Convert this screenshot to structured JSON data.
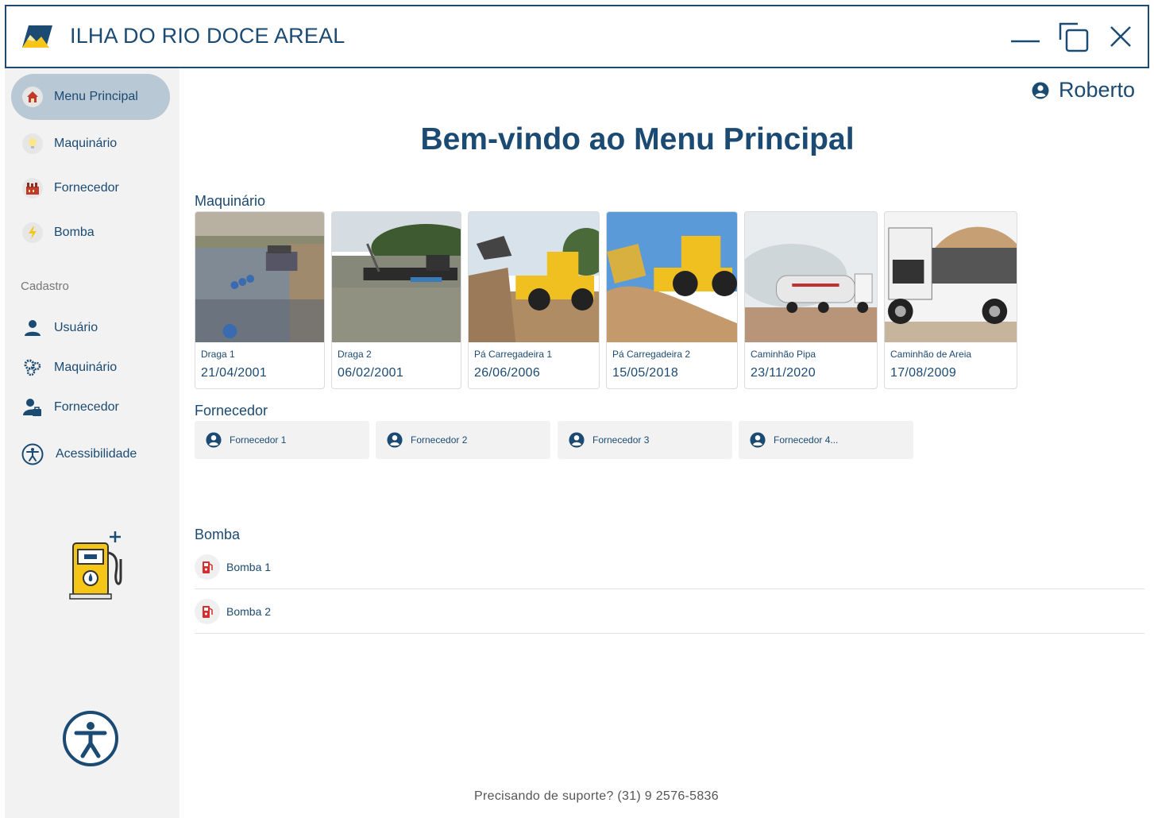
{
  "window": {
    "title": "ILHA DO RIO DOCE AREAL",
    "controls": [
      "minimize-icon",
      "restore-icon",
      "close-icon"
    ]
  },
  "sidebar": {
    "items": [
      {
        "label": "Menu Principal",
        "icon": "house-icon",
        "active": true
      },
      {
        "label": "Maquinário",
        "icon": "lightbulb-icon"
      },
      {
        "label": "Fornecedor",
        "icon": "factory-icon"
      },
      {
        "label": "Bomba",
        "icon": "lightning-icon"
      }
    ],
    "section_label": "Cadastro",
    "cadastro_items": [
      {
        "label": "Usuário",
        "icon": "user-icon"
      },
      {
        "label": "Maquinário",
        "icon": "gears-icon"
      },
      {
        "label": "Fornecedor",
        "icon": "user-briefcase-icon"
      },
      {
        "label": "Acessibilidade",
        "icon": "accessibility-icon"
      }
    ]
  },
  "header": {
    "user_name": "Roberto",
    "welcome": "Bem-vindo ao Menu Principal"
  },
  "maquinario": {
    "title": "Maquinário",
    "cards": [
      {
        "name": "Draga 1",
        "date": "21/04/2001"
      },
      {
        "name": "Draga 2",
        "date": "06/02/2001"
      },
      {
        "name": "Pá Carregadeira 1",
        "date": "26/06/2006"
      },
      {
        "name": "Pá Carregadeira 2",
        "date": "15/05/2018"
      },
      {
        "name": "Caminhão Pipa",
        "date": "23/11/2020"
      },
      {
        "name": "Caminhão de Areia",
        "date": "17/08/2009"
      }
    ]
  },
  "fornecedor": {
    "title": "Fornecedor",
    "items": [
      "Fornecedor 1",
      "Fornecedor 2",
      "Fornecedor 3",
      "Fornecedor 4..."
    ]
  },
  "bomba": {
    "title": "Bomba",
    "items": [
      "Bomba 1",
      "Bomba 2"
    ]
  },
  "footer": {
    "support": "Precisando de suporte? (31) 9 2576-5836"
  },
  "colors": {
    "primary": "#1b4a72",
    "sidebar_bg": "#f2f2f2",
    "active_bg": "#b8c8d4",
    "accent_yellow": "#f5c518"
  }
}
